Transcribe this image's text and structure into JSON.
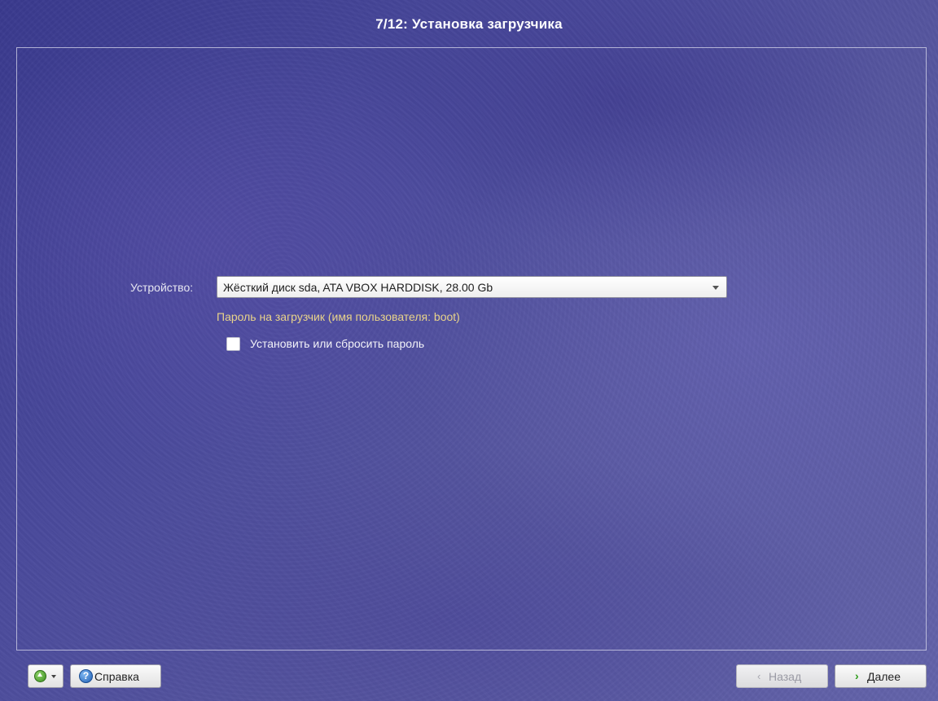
{
  "header": {
    "title": "7/12: Установка загрузчика"
  },
  "bootloader": {
    "device_label": "Устройство:",
    "device_value": "Жёсткий диск sda, ATA VBOX HARDDISK, 28.00 Gb",
    "password_caption": "Пароль на загрузчик (имя пользователя: boot)",
    "set_password_label": "Установить или сбросить пароль",
    "set_password_checked": false
  },
  "footer": {
    "menu_icon": "green-up-arrow-icon",
    "help_icon": "help-question-icon",
    "help_label": "Справка",
    "back_icon": "‹",
    "back_label": "Назад",
    "back_enabled": false,
    "next_icon": "›",
    "next_label": "Далее"
  },
  "colors": {
    "background": "#4a4a9c",
    "caption": "#e8d38a",
    "next_arrow": "#2e9d1a"
  }
}
